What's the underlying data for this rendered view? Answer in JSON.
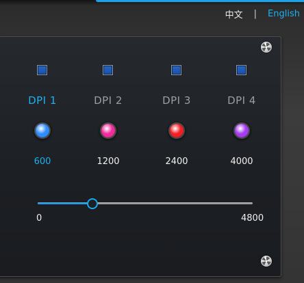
{
  "language": {
    "chinese_label": "中文",
    "separator": "|",
    "english_label": "English",
    "active": "English"
  },
  "dpi_levels": [
    {
      "label": "DPI 1",
      "value": "600",
      "color": "#2f8cff",
      "checked": true,
      "active": true
    },
    {
      "label": "DPI 2",
      "value": "1200",
      "color": "#f02c9c",
      "checked": true,
      "active": false
    },
    {
      "label": "DPI 3",
      "value": "2400",
      "color": "#f21e24",
      "checked": true,
      "active": false
    },
    {
      "label": "DPI 4",
      "value": "4000",
      "color": "#a63cf0",
      "checked": true,
      "active": false
    }
  ],
  "slider": {
    "min_label": "0",
    "max_label": "4800",
    "min": 0,
    "max": 4800,
    "value": 1200
  },
  "colors": {
    "accent": "#1eb0f0"
  },
  "icons": {
    "corner_screw": "screw-icon"
  }
}
